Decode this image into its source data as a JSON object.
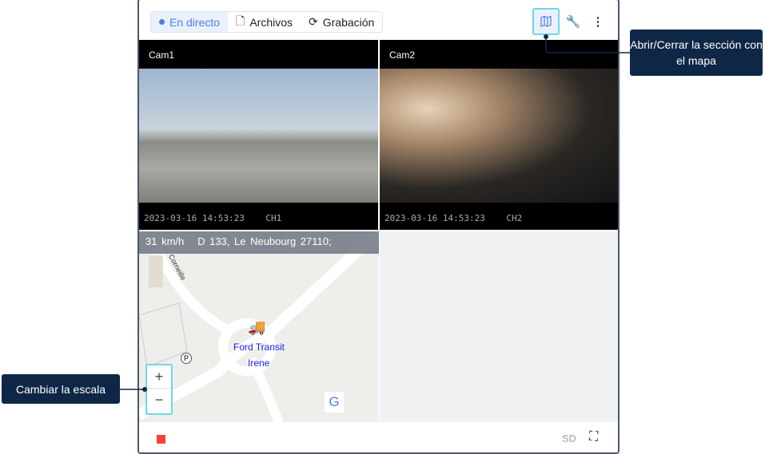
{
  "toolbar": {
    "tabs": [
      {
        "label": "En directo",
        "active": true
      },
      {
        "label": "Archivos"
      },
      {
        "label": "Grabación"
      }
    ]
  },
  "cams": [
    {
      "label": "Cam1",
      "timestamp": "2023-03-16 14:53:23",
      "channel": "CH1"
    },
    {
      "label": "Cam2",
      "timestamp": "2023-03-16 14:53:23",
      "channel": "CH2"
    }
  ],
  "map": {
    "speed": "31 km/h",
    "address": "D 133, Le Neubourg 27110;",
    "unit_name": "Ford Transit",
    "driver": "Irene",
    "street": "Corneille",
    "zoom_in": "+",
    "zoom_out": "−",
    "provider": "G"
  },
  "footer": {
    "quality": "SD"
  },
  "callouts": {
    "map_toggle": "Abrir/Cerrar la sección con el mapa",
    "zoom": "Cambiar la escala"
  },
  "colors": {
    "accent": "#4a7ee8",
    "highlight": "#6fd7e6",
    "callout": "#0f2747",
    "stop": "#f44336"
  }
}
